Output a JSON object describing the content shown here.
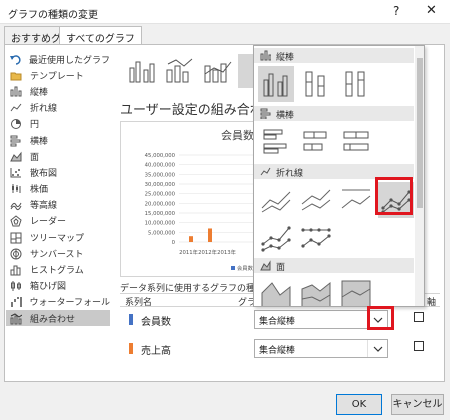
{
  "window": {
    "title": "グラフの種類の変更",
    "help": "?",
    "close": "✕"
  },
  "tabs": [
    {
      "label": "おすすめグラフ"
    },
    {
      "label": "すべてのグラフ",
      "active": true
    }
  ],
  "sidebar": {
    "items": [
      {
        "label": "最近使用したグラフ",
        "icon": "undo-icon"
      },
      {
        "label": "テンプレート",
        "icon": "folder-icon"
      },
      {
        "label": "縦棒",
        "icon": "column-chart-icon"
      },
      {
        "label": "折れ線",
        "icon": "line-chart-icon"
      },
      {
        "label": "円",
        "icon": "pie-chart-icon"
      },
      {
        "label": "横棒",
        "icon": "bar-chart-icon"
      },
      {
        "label": "面",
        "icon": "area-chart-icon"
      },
      {
        "label": "散布図",
        "icon": "scatter-chart-icon"
      },
      {
        "label": "株価",
        "icon": "stock-chart-icon"
      },
      {
        "label": "等高線",
        "icon": "surface-chart-icon"
      },
      {
        "label": "レーダー",
        "icon": "radar-chart-icon"
      },
      {
        "label": "ツリーマップ",
        "icon": "treemap-icon"
      },
      {
        "label": "サンバースト",
        "icon": "sunburst-icon"
      },
      {
        "label": "ヒストグラム",
        "icon": "histogram-icon"
      },
      {
        "label": "箱ひげ図",
        "icon": "box-whisker-icon"
      },
      {
        "label": "ウォーターフォール",
        "icon": "waterfall-icon"
      },
      {
        "label": "組み合わせ",
        "icon": "combo-chart-icon",
        "selected": true
      }
    ]
  },
  "main": {
    "heading": "ユーザー設定の組み合わせ",
    "series_caption": "データ系列に使用するグラフの種類と軸を",
    "columns": {
      "series": "系列名",
      "type": "グラ",
      "axis": "軸"
    },
    "series": [
      {
        "name": "会員数",
        "color": "#4472c4",
        "type": "集合縦棒"
      },
      {
        "name": "売上高",
        "color": "#ed7d31",
        "type": "集合縦棒"
      }
    ]
  },
  "preview": {
    "title": "会員数",
    "legend_label": "会員数"
  },
  "chart_data": {
    "type": "bar",
    "title": "会員数",
    "categories": [
      "2011年",
      "2012年",
      "2013年",
      "2014年",
      "2015年",
      "2016年"
    ],
    "series": [
      {
        "name": "会員数",
        "values": [
          0,
          0,
          0,
          0,
          0,
          0
        ],
        "color": "#4472c4"
      },
      {
        "name": "売上高",
        "values": [
          3000000,
          7000000,
          0,
          0,
          0,
          0
        ],
        "color": "#ed7d31"
      }
    ],
    "yticks": [
      "45,000,000",
      "40,000,000",
      "35,000,000",
      "30,000,000",
      "25,000,000",
      "20,000,000",
      "15,000,000",
      "10,000,000",
      "5,000,000",
      "0"
    ],
    "ylim": [
      0,
      45000000
    ],
    "grid": true,
    "legend": "bottom"
  },
  "dropdown": {
    "sections": [
      {
        "label": "縦棒",
        "icon": "column-chart-icon"
      },
      {
        "label": "横棒",
        "icon": "bar-chart-icon"
      },
      {
        "label": "折れ線",
        "icon": "line-chart-icon"
      },
      {
        "label": "面",
        "icon": "area-chart-icon"
      }
    ]
  },
  "buttons": {
    "ok": "OK",
    "cancel": "キャンセル"
  },
  "colors": {
    "highlight": "#e0161f",
    "accent": "#0078d7"
  }
}
